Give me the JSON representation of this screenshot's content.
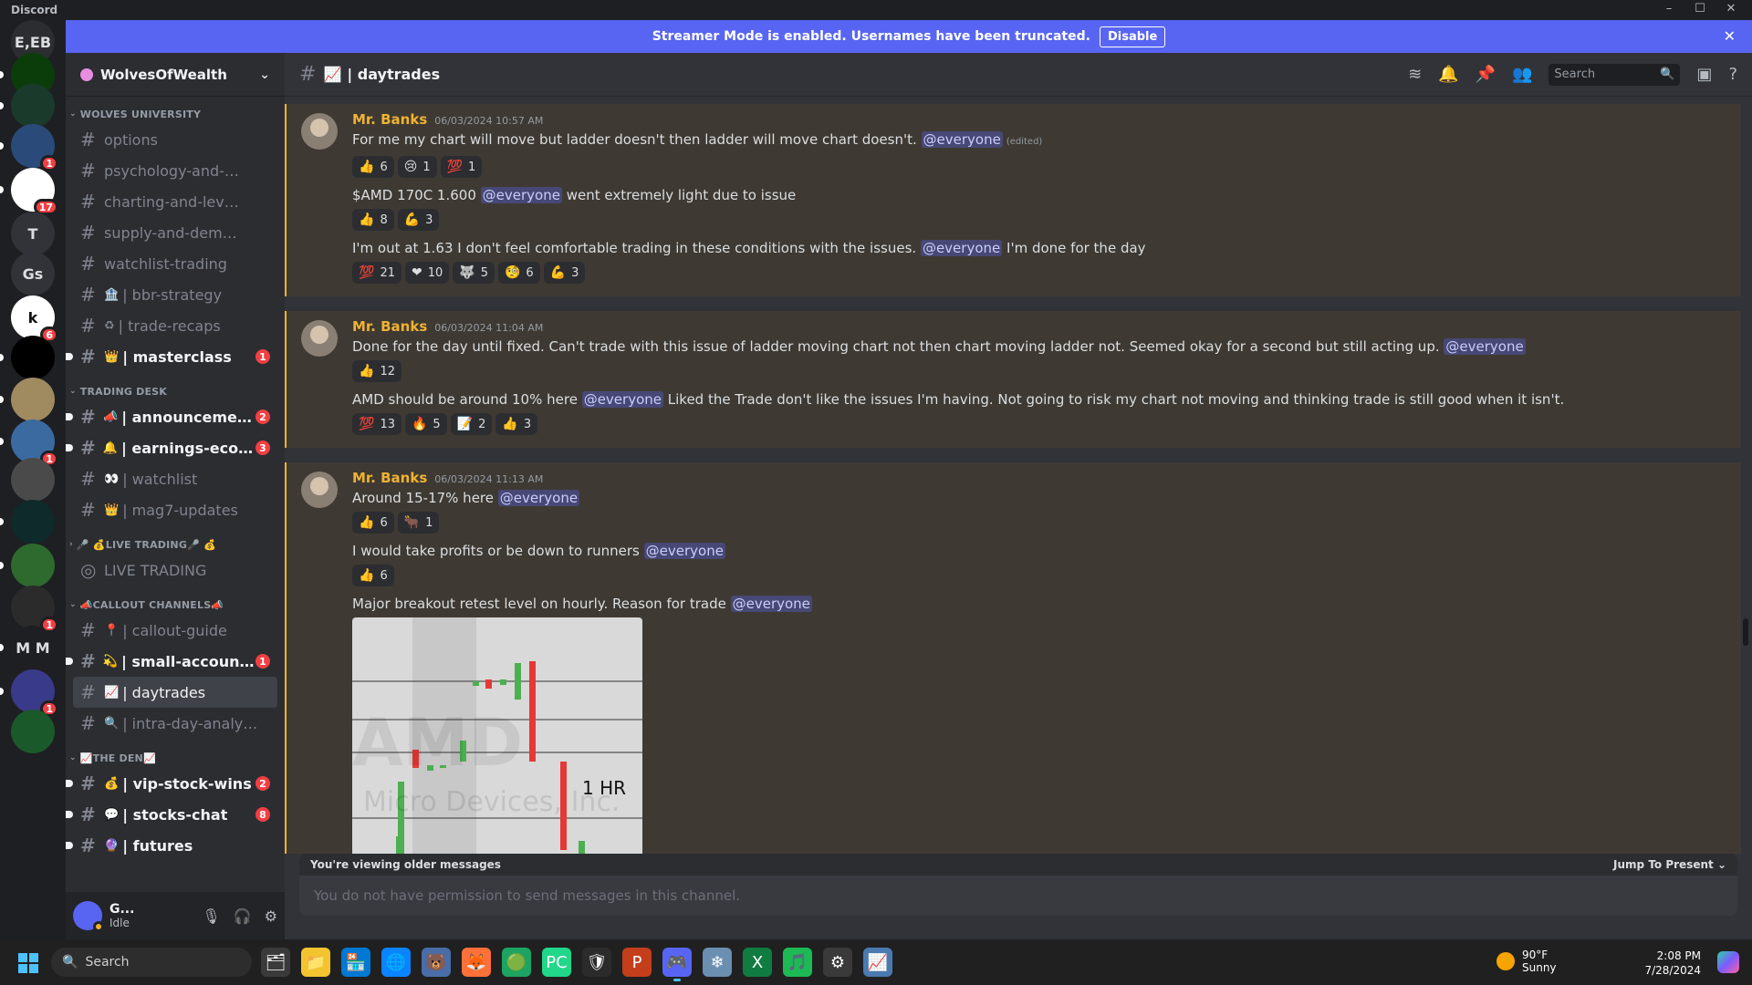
{
  "titlebar": {
    "app_name": "Discord",
    "min": "–",
    "max": "☐",
    "close": "✕"
  },
  "banner": {
    "text": "Streamer Mode is enabled. Usernames have been truncated.",
    "disable_label": "Disable",
    "close": "✕"
  },
  "servers": [
    {
      "label": "E,EB",
      "badge": ""
    },
    {
      "label": "",
      "badge": ""
    },
    {
      "label": "",
      "badge": ""
    },
    {
      "label": "",
      "badge": "1"
    },
    {
      "label": "",
      "badge": "17"
    },
    {
      "label": "T",
      "badge": ""
    },
    {
      "label": "Gs",
      "badge": ""
    },
    {
      "label": "k",
      "badge": "6"
    },
    {
      "label": "",
      "badge": ""
    },
    {
      "label": "",
      "badge": ""
    },
    {
      "label": "",
      "badge": "1"
    },
    {
      "label": "",
      "badge": ""
    },
    {
      "label": "",
      "badge": ""
    },
    {
      "label": "",
      "badge": ""
    },
    {
      "label": "",
      "badge": "1"
    },
    {
      "label": "M M",
      "badge": ""
    },
    {
      "label": "",
      "badge": "1"
    },
    {
      "label": "",
      "badge": ""
    }
  ],
  "guild": {
    "name": "WolvesOfWealth"
  },
  "categories": {
    "university": "WOLVES UNIVERSITY",
    "trading_desk": "TRADING DESK",
    "live_trading": "LIVE TRADING",
    "callout": "CALLOUT CHANNELS",
    "den": "THE DEN"
  },
  "channels_university": [
    {
      "label": "options",
      "emoji": "",
      "unread": false,
      "mention": ""
    },
    {
      "label": "psychology-and-strategi...",
      "emoji": "",
      "unread": false,
      "mention": ""
    },
    {
      "label": "charting-and-levels",
      "emoji": "",
      "unread": false,
      "mention": ""
    },
    {
      "label": "supply-and-demand",
      "emoji": "",
      "unread": false,
      "mention": ""
    },
    {
      "label": "watchlist-trading",
      "emoji": "",
      "unread": false,
      "mention": ""
    },
    {
      "label": "| bbr-strategy",
      "emoji": "🏦",
      "unread": false,
      "mention": ""
    },
    {
      "label": "| trade-recaps",
      "emoji": "♻",
      "unread": false,
      "mention": ""
    },
    {
      "label": "| masterclass",
      "emoji": "👑",
      "unread": true,
      "mention": "1"
    }
  ],
  "channels_desk": [
    {
      "label": "| announcements",
      "emoji": "📣",
      "unread": true,
      "mention": "2"
    },
    {
      "label": "| earnings-econo...",
      "emoji": "🔔",
      "unread": true,
      "mention": "3"
    },
    {
      "label": "| watchlist",
      "emoji": "👀",
      "unread": false,
      "mention": ""
    },
    {
      "label": "| mag7-updates",
      "emoji": "👑",
      "unread": false,
      "mention": ""
    }
  ],
  "live_channel": "LIVE TRADING",
  "channels_callout": [
    {
      "label": "| callout-guide",
      "emoji": "📍",
      "unread": false,
      "mention": "",
      "selected": false
    },
    {
      "label": "| small-account-...",
      "emoji": "💫",
      "unread": true,
      "mention": "1",
      "selected": false
    },
    {
      "label": "| daytrades",
      "emoji": "📈",
      "unread": false,
      "mention": "",
      "selected": true
    },
    {
      "label": "| intra-day-analysis",
      "emoji": "🔍",
      "unread": false,
      "mention": "",
      "selected": false
    }
  ],
  "channels_den": [
    {
      "label": "| vip-stock-wins",
      "emoji": "💰",
      "unread": true,
      "mention": "2"
    },
    {
      "label": "| stocks-chat",
      "emoji": "💬",
      "unread": true,
      "mention": "8"
    },
    {
      "label": "| futures",
      "emoji": "🔮",
      "unread": true,
      "mention": ""
    }
  ],
  "user": {
    "name": "G...",
    "status": "Idle"
  },
  "chat": {
    "channel_title": "| daytrades",
    "search_placeholder": "Search",
    "older_text": "You're viewing older messages",
    "jump_label": "Jump To Present",
    "composer_placeholder": "You do not have permission to send messages in this channel."
  },
  "messages": [
    {
      "author": "Mr. Banks",
      "timestamp": "06/03/2024 10:57 AM",
      "lines": [
        {
          "text": "For me my chart will move but ladder doesn't then ladder will move chart doesn't.",
          "mention": "@everyone",
          "edited": "(edited)",
          "reactions": [
            [
              "👍",
              "6"
            ],
            [
              "😢",
              "1"
            ],
            [
              "💯",
              "1"
            ]
          ]
        },
        {
          "text": "$AMD 170C 1.600",
          "mention": "@everyone",
          "after": "went extremely light due to issue",
          "edited": "",
          "reactions": [
            [
              "👍",
              "8"
            ],
            [
              "💪",
              "3"
            ]
          ]
        },
        {
          "text": "I'm out at 1.63 I don't feel comfortable trading in these conditions with the issues.",
          "mention": "@everyone",
          "after": "I'm done for the day",
          "edited": "",
          "reactions": [
            [
              "💯",
              "21"
            ],
            [
              "❤",
              "10"
            ],
            [
              "🐺",
              "5"
            ],
            [
              "🧐",
              "6"
            ],
            [
              "💪",
              "3"
            ]
          ]
        }
      ]
    },
    {
      "author": "Mr. Banks",
      "timestamp": "06/03/2024 11:04 AM",
      "lines": [
        {
          "text": "Done for the day until fixed. Can't trade with this issue of ladder moving chart not then chart moving ladder not. Seemed okay for a second but still acting up.",
          "mention": "@everyone",
          "edited": "",
          "reactions": [
            [
              "👍",
              "12"
            ]
          ]
        },
        {
          "text": "AMD should be around 10% here",
          "mention": "@everyone",
          "after": "Liked the Trade don't like the issues I'm having. Not going to risk my chart not moving and thinking trade is still good when it isn't.",
          "edited": "",
          "reactions": [
            [
              "💯",
              "13"
            ],
            [
              "🔥",
              "5"
            ],
            [
              "📝",
              "2"
            ],
            [
              "👍",
              "3"
            ]
          ]
        }
      ]
    },
    {
      "author": "Mr. Banks",
      "timestamp": "06/03/2024 11:13 AM",
      "lines": [
        {
          "text": "Around 15-17% here",
          "mention": "@everyone",
          "edited": "",
          "reactions": [
            [
              "👍",
              "6"
            ],
            [
              "🐂",
              "1"
            ]
          ]
        },
        {
          "text": "I would take profits or be down to runners",
          "mention": "@everyone",
          "edited": "",
          "reactions": [
            [
              "👍",
              "6"
            ]
          ]
        },
        {
          "text": "Major breakout retest level on hourly. Reason for trade",
          "mention": "@everyone",
          "edited": "",
          "reactions": []
        }
      ],
      "image": {
        "watermark": "AMD",
        "watermark_sub": "Micro Devices, Inc.",
        "label": "1 HR"
      }
    }
  ],
  "taskbar": {
    "search_label": "Search",
    "weather_temp": "90°F",
    "weather_cond": "Sunny",
    "time": "2:08 PM",
    "date": "7/28/2024",
    "apps": [
      "🗂",
      "📁",
      "🏪",
      "🌐",
      "🐻",
      "🦊",
      "🟢",
      "PC",
      "🛡",
      "P",
      "🎮",
      "❄",
      "X",
      "🎵",
      "⚙",
      "📈"
    ]
  }
}
